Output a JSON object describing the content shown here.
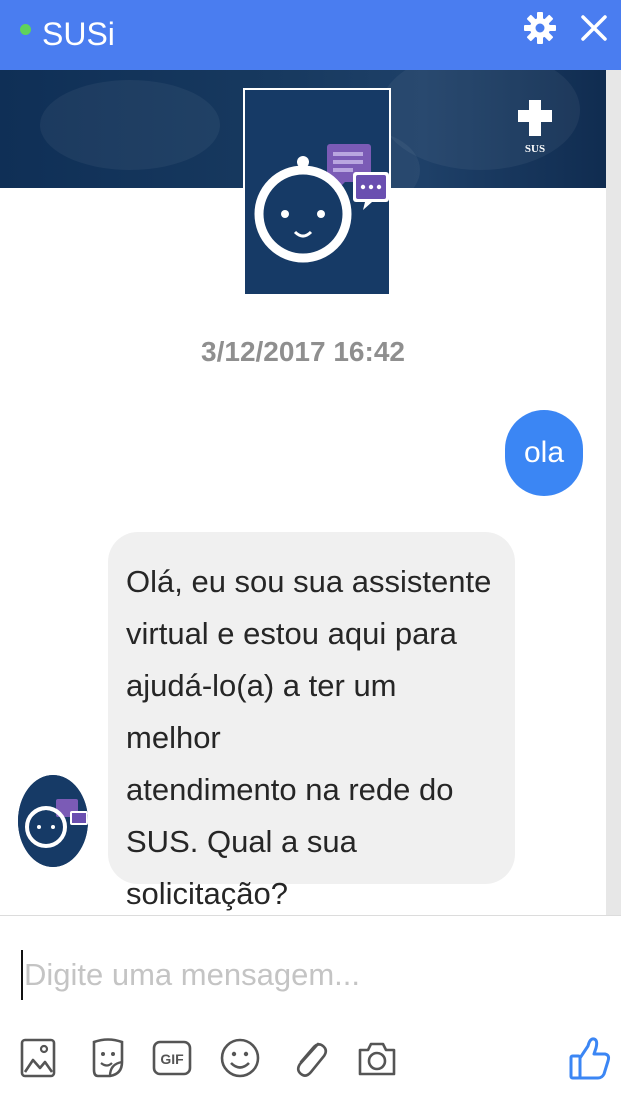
{
  "header": {
    "title": "SUSi",
    "status": "online",
    "status_color": "#5fd35a",
    "bar_color": "#4a7df0",
    "icons": [
      "gear-icon",
      "close-icon"
    ]
  },
  "banner": {
    "logo_text": "SUS",
    "icons": [
      "sus-logo-icon",
      "bot-avatar-icon"
    ]
  },
  "conversation": {
    "timestamp": "3/12/2017 16:42",
    "messages": [
      {
        "from": "user",
        "text": "ola",
        "color": "#3b86f4"
      },
      {
        "from": "bot",
        "lines": [
          "Olá, eu sou sua assistente",
          "virtual e estou aqui para",
          "ajudá-lo(a) a ter um melhor",
          "atendimento na rede do",
          "SUS. Qual a sua",
          "solicitação?"
        ]
      }
    ]
  },
  "composer": {
    "placeholder": "Digite uma mensagem...",
    "value": "",
    "toolbar": [
      "image-icon",
      "sticker-icon",
      "gif-icon",
      "emoji-icon",
      "attachment-icon",
      "camera-icon",
      "thumbs-up-icon"
    ],
    "gif_label": "GIF",
    "accent": "#3b86f4"
  }
}
